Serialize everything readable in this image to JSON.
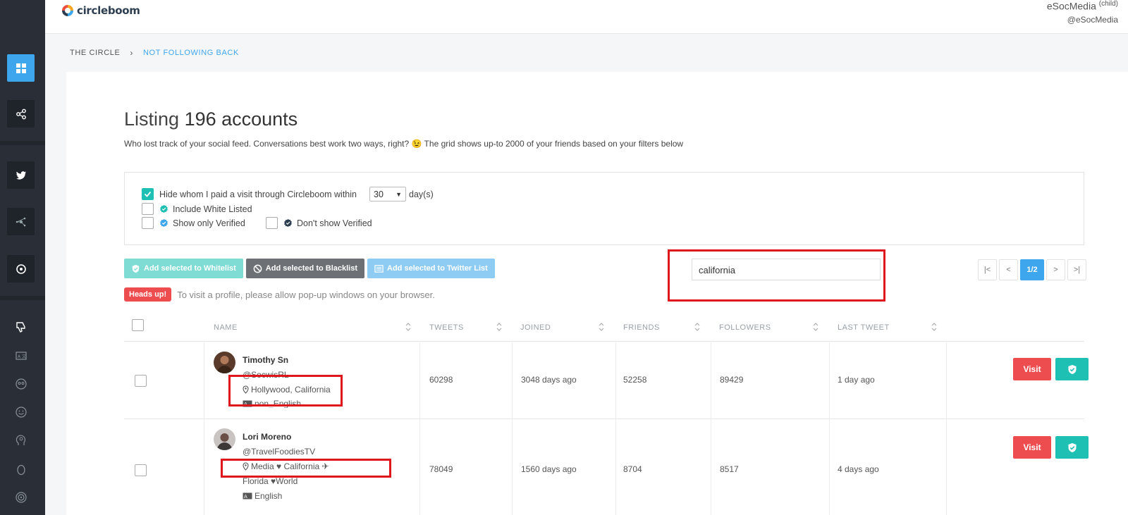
{
  "app": {
    "logo_text": "circleboom"
  },
  "user": {
    "name": "eSocMedia",
    "tag": "(child)",
    "handle": "@eSocMedia"
  },
  "breadcrumb": [
    "THE CIRCLE",
    "NOT FOLLOWING BACK"
  ],
  "page": {
    "title_prefix": "Listing",
    "title_count": "196 accounts",
    "subtitle": "Who lost track of your social feed. Conversations best work two ways, right?  😉 The grid shows up-to 2000 of your friends based on your filters below"
  },
  "filters": {
    "hide_visited_label": "Hide whom I paid a visit through Circleboom within",
    "hide_visited_checked": true,
    "days_value": "30",
    "days_unit": "day(s)",
    "include_whitelisted": "Include White Listed",
    "only_verified": "Show only Verified",
    "dont_show_verified": "Don't show Verified"
  },
  "actions": {
    "whitelist": "Add selected to Whitelist",
    "blacklist": "Add selected to Blacklist",
    "twitter_list": "Add selected to Twitter List"
  },
  "headsup": {
    "badge": "Heads up!",
    "text": "To visit a profile, please allow pop-up windows on your browser."
  },
  "search": {
    "value": "california"
  },
  "pagination": {
    "first": "|<",
    "prev": "<",
    "current": "1/2",
    "next": ">",
    "last": ">|"
  },
  "table": {
    "columns": [
      "NAME",
      "TWEETS",
      "JOINED",
      "FRIENDS",
      "FOLLOWERS",
      "LAST TWEET"
    ],
    "rows": [
      {
        "name": "Timothy Sn",
        "handle": "@SocwisRL",
        "location": "Hollywood, California",
        "language": "non_English",
        "tweets": "60298",
        "joined": "3048 days ago",
        "friends": "52258",
        "followers": "89429",
        "last_tweet": "1 day ago",
        "visit_label": "Visit"
      },
      {
        "name": "Lori Moreno",
        "handle": "@TravelFoodiesTV",
        "location": "Media ♥ California ✈",
        "location_extra": "Florida ♥World",
        "language": "English",
        "tweets": "78049",
        "joined": "1560 days ago",
        "friends": "8704",
        "followers": "8517",
        "last_tweet": "4 days ago",
        "visit_label": "Visit"
      }
    ]
  },
  "colors": {
    "accent": "#3ea6ec",
    "teal": "#1fc0b4",
    "red": "#ee4d4f",
    "highlight": "#e0161d",
    "sidebar": "#2a2f37"
  }
}
